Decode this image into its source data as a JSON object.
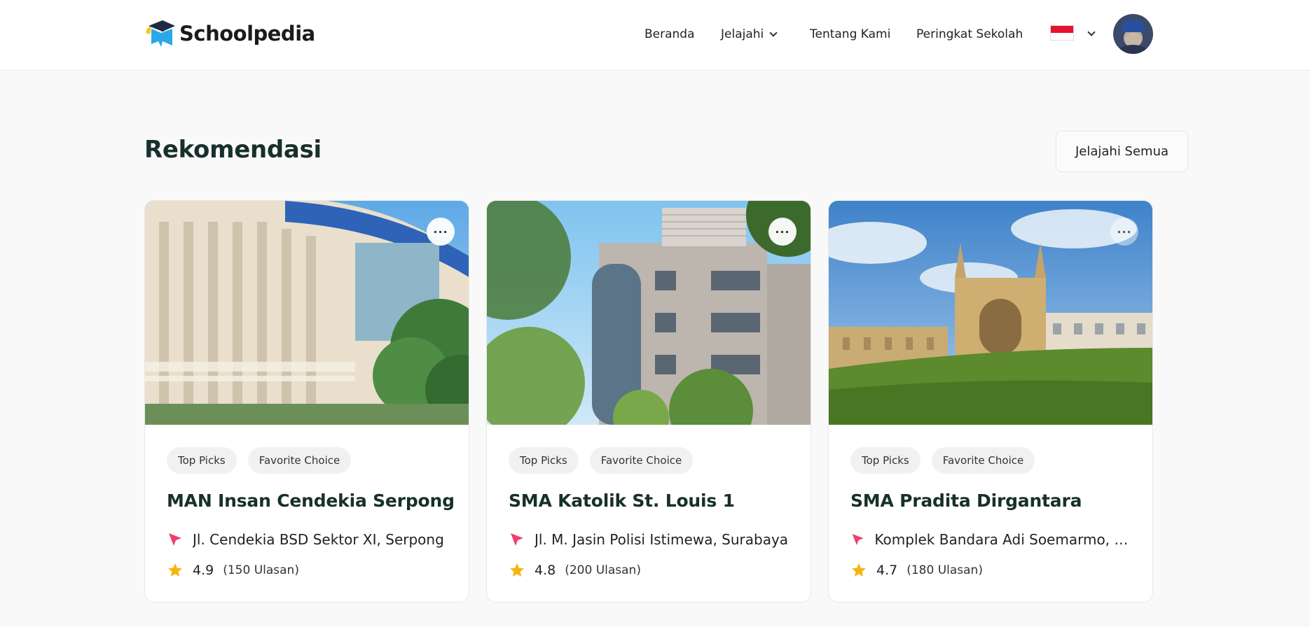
{
  "header": {
    "brand": "Schoolpedia",
    "nav": {
      "home": "Beranda",
      "explore": "Jelajahi",
      "about": "Tentang Kami",
      "ranking": "Peringkat Sekolah"
    },
    "language_icon": "indonesia-flag",
    "colors": {
      "brand_blue": "#2aa8e8",
      "brand_accent": "#f5c518"
    }
  },
  "section": {
    "title": "Rekomendasi",
    "explore_all": "Jelajahi Semua"
  },
  "cards": [
    {
      "image_subject": "university-building-photo",
      "tags": [
        "Top Picks",
        "Favorite Choice"
      ],
      "name": "MAN Insan Cendekia Serpong",
      "address": "Jl. Cendekia BSD Sektor XI, Serpong",
      "rating": "4.9",
      "reviews": "(150 Ulasan)"
    },
    {
      "image_subject": "modern-school-building-photo",
      "tags": [
        "Top Picks",
        "Favorite Choice"
      ],
      "name": "SMA Katolik St. Louis 1",
      "address": "Jl. M. Jasin Polisi Istimewa, Surabaya",
      "rating": "4.8",
      "reviews": "(200 Ulasan)"
    },
    {
      "image_subject": "gothic-chapel-photo",
      "tags": [
        "Top Picks",
        "Favorite Choice"
      ],
      "name": "SMA Pradita Dirgantara",
      "address": "Komplek Bandara Adi Soemarmo, Boyolali",
      "rating": "4.7",
      "reviews": "(180 Ulasan)"
    }
  ],
  "icons": {
    "location": "location-arrow-icon",
    "star": "star-icon",
    "more": "more-options-icon"
  },
  "accent_colors": {
    "location_pink": "#f03e6e",
    "star_yellow": "#f6b40e"
  }
}
